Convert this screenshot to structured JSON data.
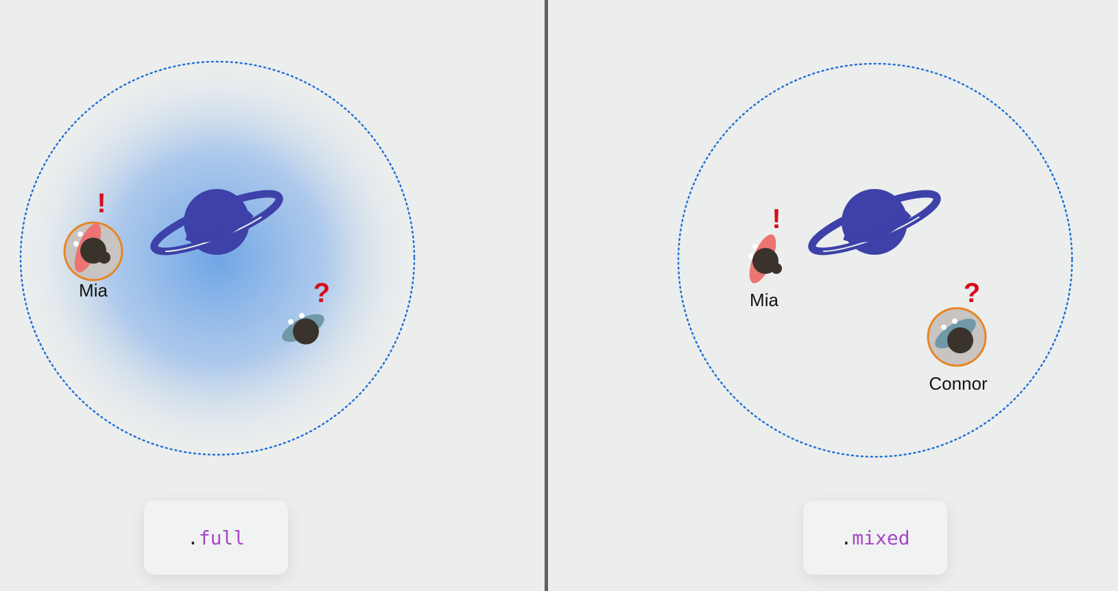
{
  "left_panel": {
    "people": [
      {
        "name": "Mia",
        "indicator": "!",
        "highlighted": true
      },
      {
        "name": "",
        "indicator": "?",
        "highlighted": false
      }
    ],
    "mode_chip": {
      "dot": ".",
      "word": "full"
    }
  },
  "right_panel": {
    "people": [
      {
        "name": "Mia",
        "indicator": "!",
        "highlighted": false
      },
      {
        "name": "Connor",
        "indicator": "?",
        "highlighted": true
      }
    ],
    "mode_chip": {
      "dot": ".",
      "word": "mixed"
    }
  },
  "colors": {
    "background": "#eceeed",
    "planet": "#3d41a8",
    "boundary": "#1e6fd6",
    "glow": "#6fa5e6",
    "highlight_ring": "#e88424",
    "indicator": "#d60d18",
    "mia_body": "#ec7473",
    "connor_body": "#6f99a6",
    "head": "#3a332c",
    "code_keyword": "#a547c8",
    "divider": "#5f6163"
  },
  "icons": [
    "planet-icon",
    "person-icon",
    "exclamation-icon",
    "question-icon"
  ]
}
